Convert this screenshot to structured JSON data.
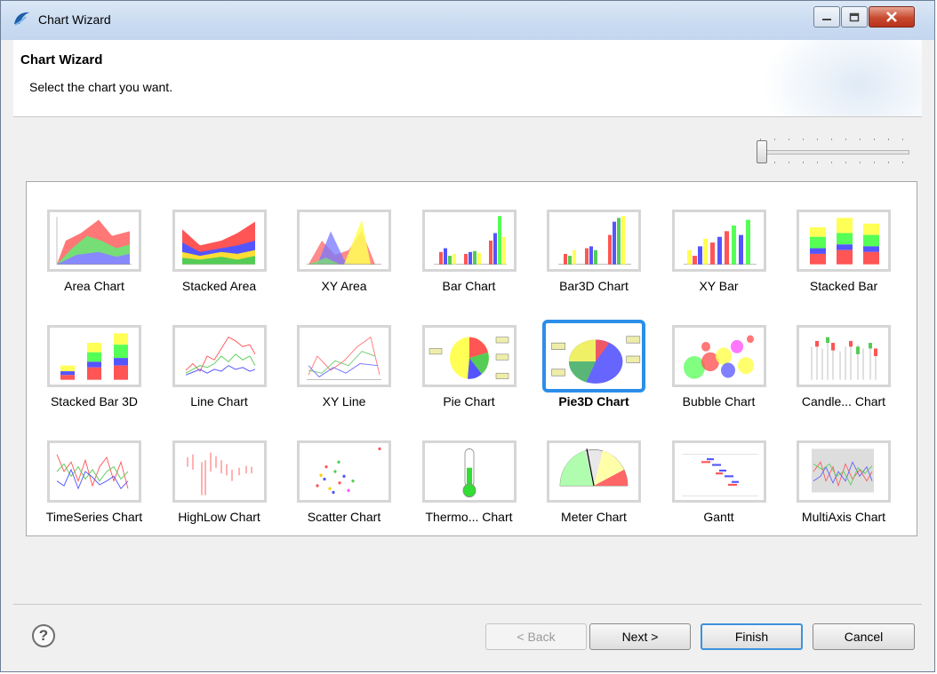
{
  "window": {
    "title": "Chart Wizard"
  },
  "header": {
    "title": "Chart Wizard",
    "description": "Select the chart you want."
  },
  "charts": [
    {
      "label": "Area Chart",
      "icon": "area-chart-thumbnail"
    },
    {
      "label": "Stacked Area",
      "icon": "stacked-area-thumbnail"
    },
    {
      "label": "XY Area",
      "icon": "xy-area-thumbnail"
    },
    {
      "label": "Bar Chart",
      "icon": "bar-chart-thumbnail"
    },
    {
      "label": "Bar3D Chart",
      "icon": "bar3d-chart-thumbnail"
    },
    {
      "label": "XY Bar",
      "icon": "xy-bar-thumbnail"
    },
    {
      "label": "Stacked Bar",
      "icon": "stacked-bar-thumbnail"
    },
    {
      "label": "Stacked Bar 3D",
      "icon": "stacked-bar-3d-thumbnail"
    },
    {
      "label": "Line Chart",
      "icon": "line-chart-thumbnail"
    },
    {
      "label": "XY Line",
      "icon": "xy-line-thumbnail"
    },
    {
      "label": "Pie Chart",
      "icon": "pie-chart-thumbnail"
    },
    {
      "label": "Pie3D Chart",
      "icon": "pie3d-chart-thumbnail",
      "selected": true
    },
    {
      "label": "Bubble Chart",
      "icon": "bubble-chart-thumbnail"
    },
    {
      "label": "Candle... Chart",
      "icon": "candlestick-chart-thumbnail"
    },
    {
      "label": "TimeSeries Chart",
      "icon": "timeseries-chart-thumbnail"
    },
    {
      "label": "HighLow Chart",
      "icon": "highlow-chart-thumbnail"
    },
    {
      "label": "Scatter Chart",
      "icon": "scatter-chart-thumbnail"
    },
    {
      "label": "Thermo... Chart",
      "icon": "thermometer-chart-thumbnail"
    },
    {
      "label": "Meter Chart",
      "icon": "meter-chart-thumbnail"
    },
    {
      "label": "Gantt",
      "icon": "gantt-chart-thumbnail"
    },
    {
      "label": "MultiAxis Chart",
      "icon": "multiaxis-chart-thumbnail"
    }
  ],
  "buttons": {
    "back": "< Back",
    "next": "Next >",
    "finish": "Finish",
    "cancel": "Cancel"
  },
  "help": {
    "glyph": "?"
  },
  "colors": {
    "selection": "#2b8ee8",
    "red": "#ff5555",
    "green": "#55ff55",
    "blue": "#5555ff",
    "yellow": "#ffff55"
  }
}
